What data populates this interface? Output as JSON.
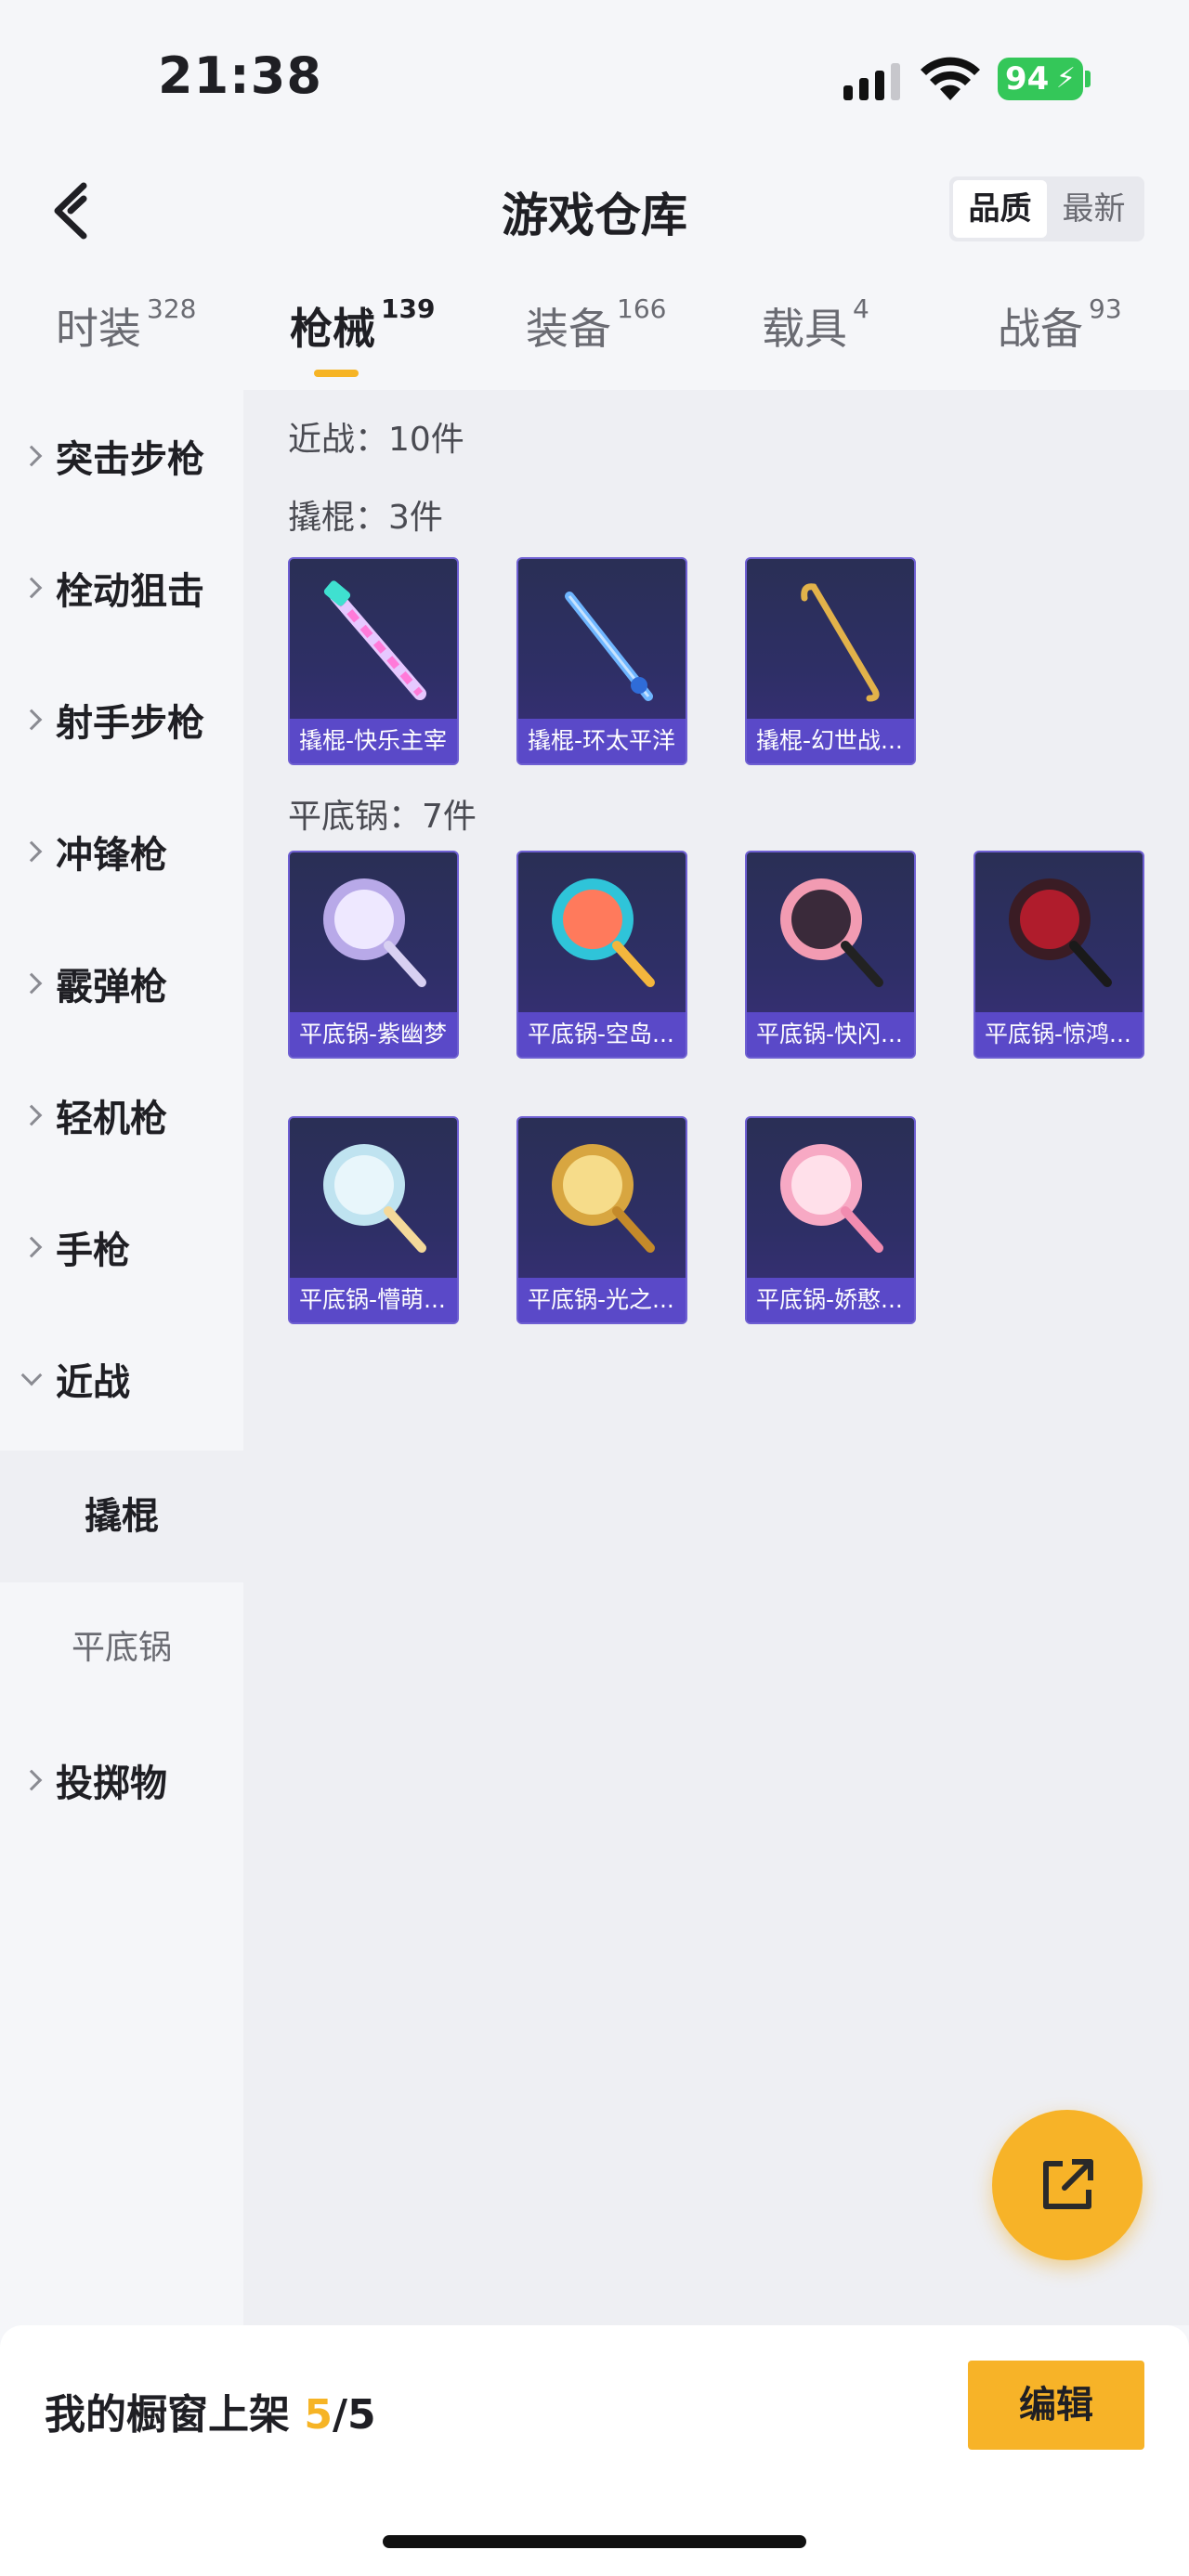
{
  "status_bar": {
    "time": "21:38",
    "battery": "94"
  },
  "header": {
    "title": "游戏仓库",
    "sort": [
      "品质",
      "最新"
    ]
  },
  "tabs": [
    {
      "label": "时装",
      "count": "328"
    },
    {
      "label": "枪械",
      "count": "139"
    },
    {
      "label": "装备",
      "count": "166"
    },
    {
      "label": "载具",
      "count": "4"
    },
    {
      "label": "战备",
      "count": "93"
    }
  ],
  "sidebar": {
    "items": [
      "突击步枪",
      "栓动狙击",
      "射手步枪",
      "冲锋枪",
      "霰弹枪",
      "轻机枪",
      "手枪",
      "近战"
    ],
    "sub_items": [
      "撬棍",
      "平底锅"
    ],
    "last_item": "投掷物"
  },
  "content": {
    "melee_total": "近战：10件",
    "crowbar_label": "撬棍：3件",
    "crowbar_items": [
      "撬棍-快乐主宰",
      "撬棍-环太平洋",
      "撬棍-幻世战..."
    ],
    "pan_label": "平底锅：7件",
    "pan_items": [
      "平底锅-紫幽梦",
      "平底锅-空岛...",
      "平底锅-快闪...",
      "平底锅-惊鸿...",
      "平底锅-懵萌...",
      "平底锅-光之...",
      "平底锅-娇憨..."
    ]
  },
  "bottom_bar": {
    "label": "我的橱窗上架",
    "current": "5",
    "total": "/5",
    "edit_label": "编辑"
  },
  "colors": {
    "accent": "#f6b425",
    "card_purple": "#5a49c8"
  }
}
